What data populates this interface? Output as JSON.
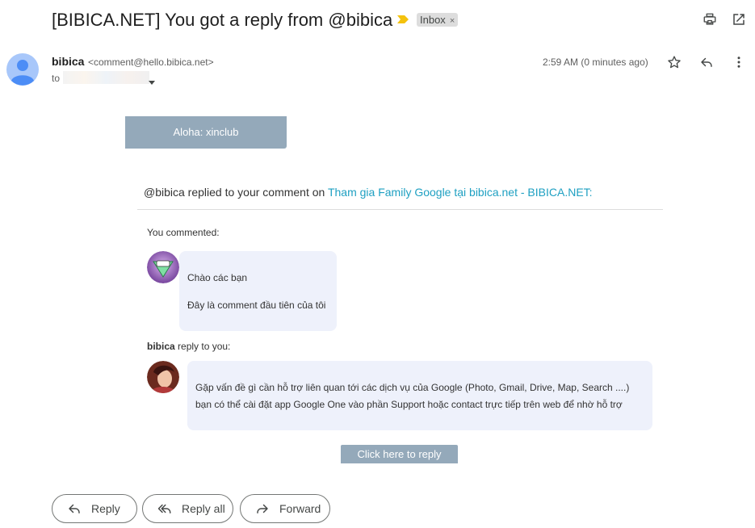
{
  "header": {
    "subject": "[BIBICA.NET] You got a reply from @bibica",
    "label": "Inbox",
    "label_remove": "×"
  },
  "sender": {
    "name": "bibica",
    "email": "<comment@hello.bibica.net>",
    "to_label": "to",
    "timestamp": "2:59 AM (0 minutes ago)"
  },
  "body": {
    "greeting": "Aloha: xinclub",
    "notify_prefix": "@bibica replied to your comment on ",
    "notify_link": "Tham gia Family Google tại bibica.net - BIBICA.NET:",
    "you_commented": "You commented:",
    "comment_lines": [
      "Chào các bạn",
      "Đây là comment đầu tiên của tôi"
    ],
    "replier_name": "bibica",
    "reply_suffix": " reply to you:",
    "reply_lines": [
      "Gặp vấn đề gì cần hỗ trợ liên quan tới các dịch vụ của Google (Photo, Gmail, Drive, Map, Search ....)",
      "bạn có thể cài đặt app Google One vào phần Support hoặc contact trực tiếp trên web để nhờ hỗ trợ"
    ],
    "click_reply": "Click here to reply"
  },
  "actions": {
    "reply": "Reply",
    "reply_all": "Reply all",
    "forward": "Forward"
  },
  "colors": {
    "accent_bar": "#94a9ba",
    "link": "#1fa0c2",
    "bubble": "#eef1fb",
    "importance": "#f4c20d"
  }
}
